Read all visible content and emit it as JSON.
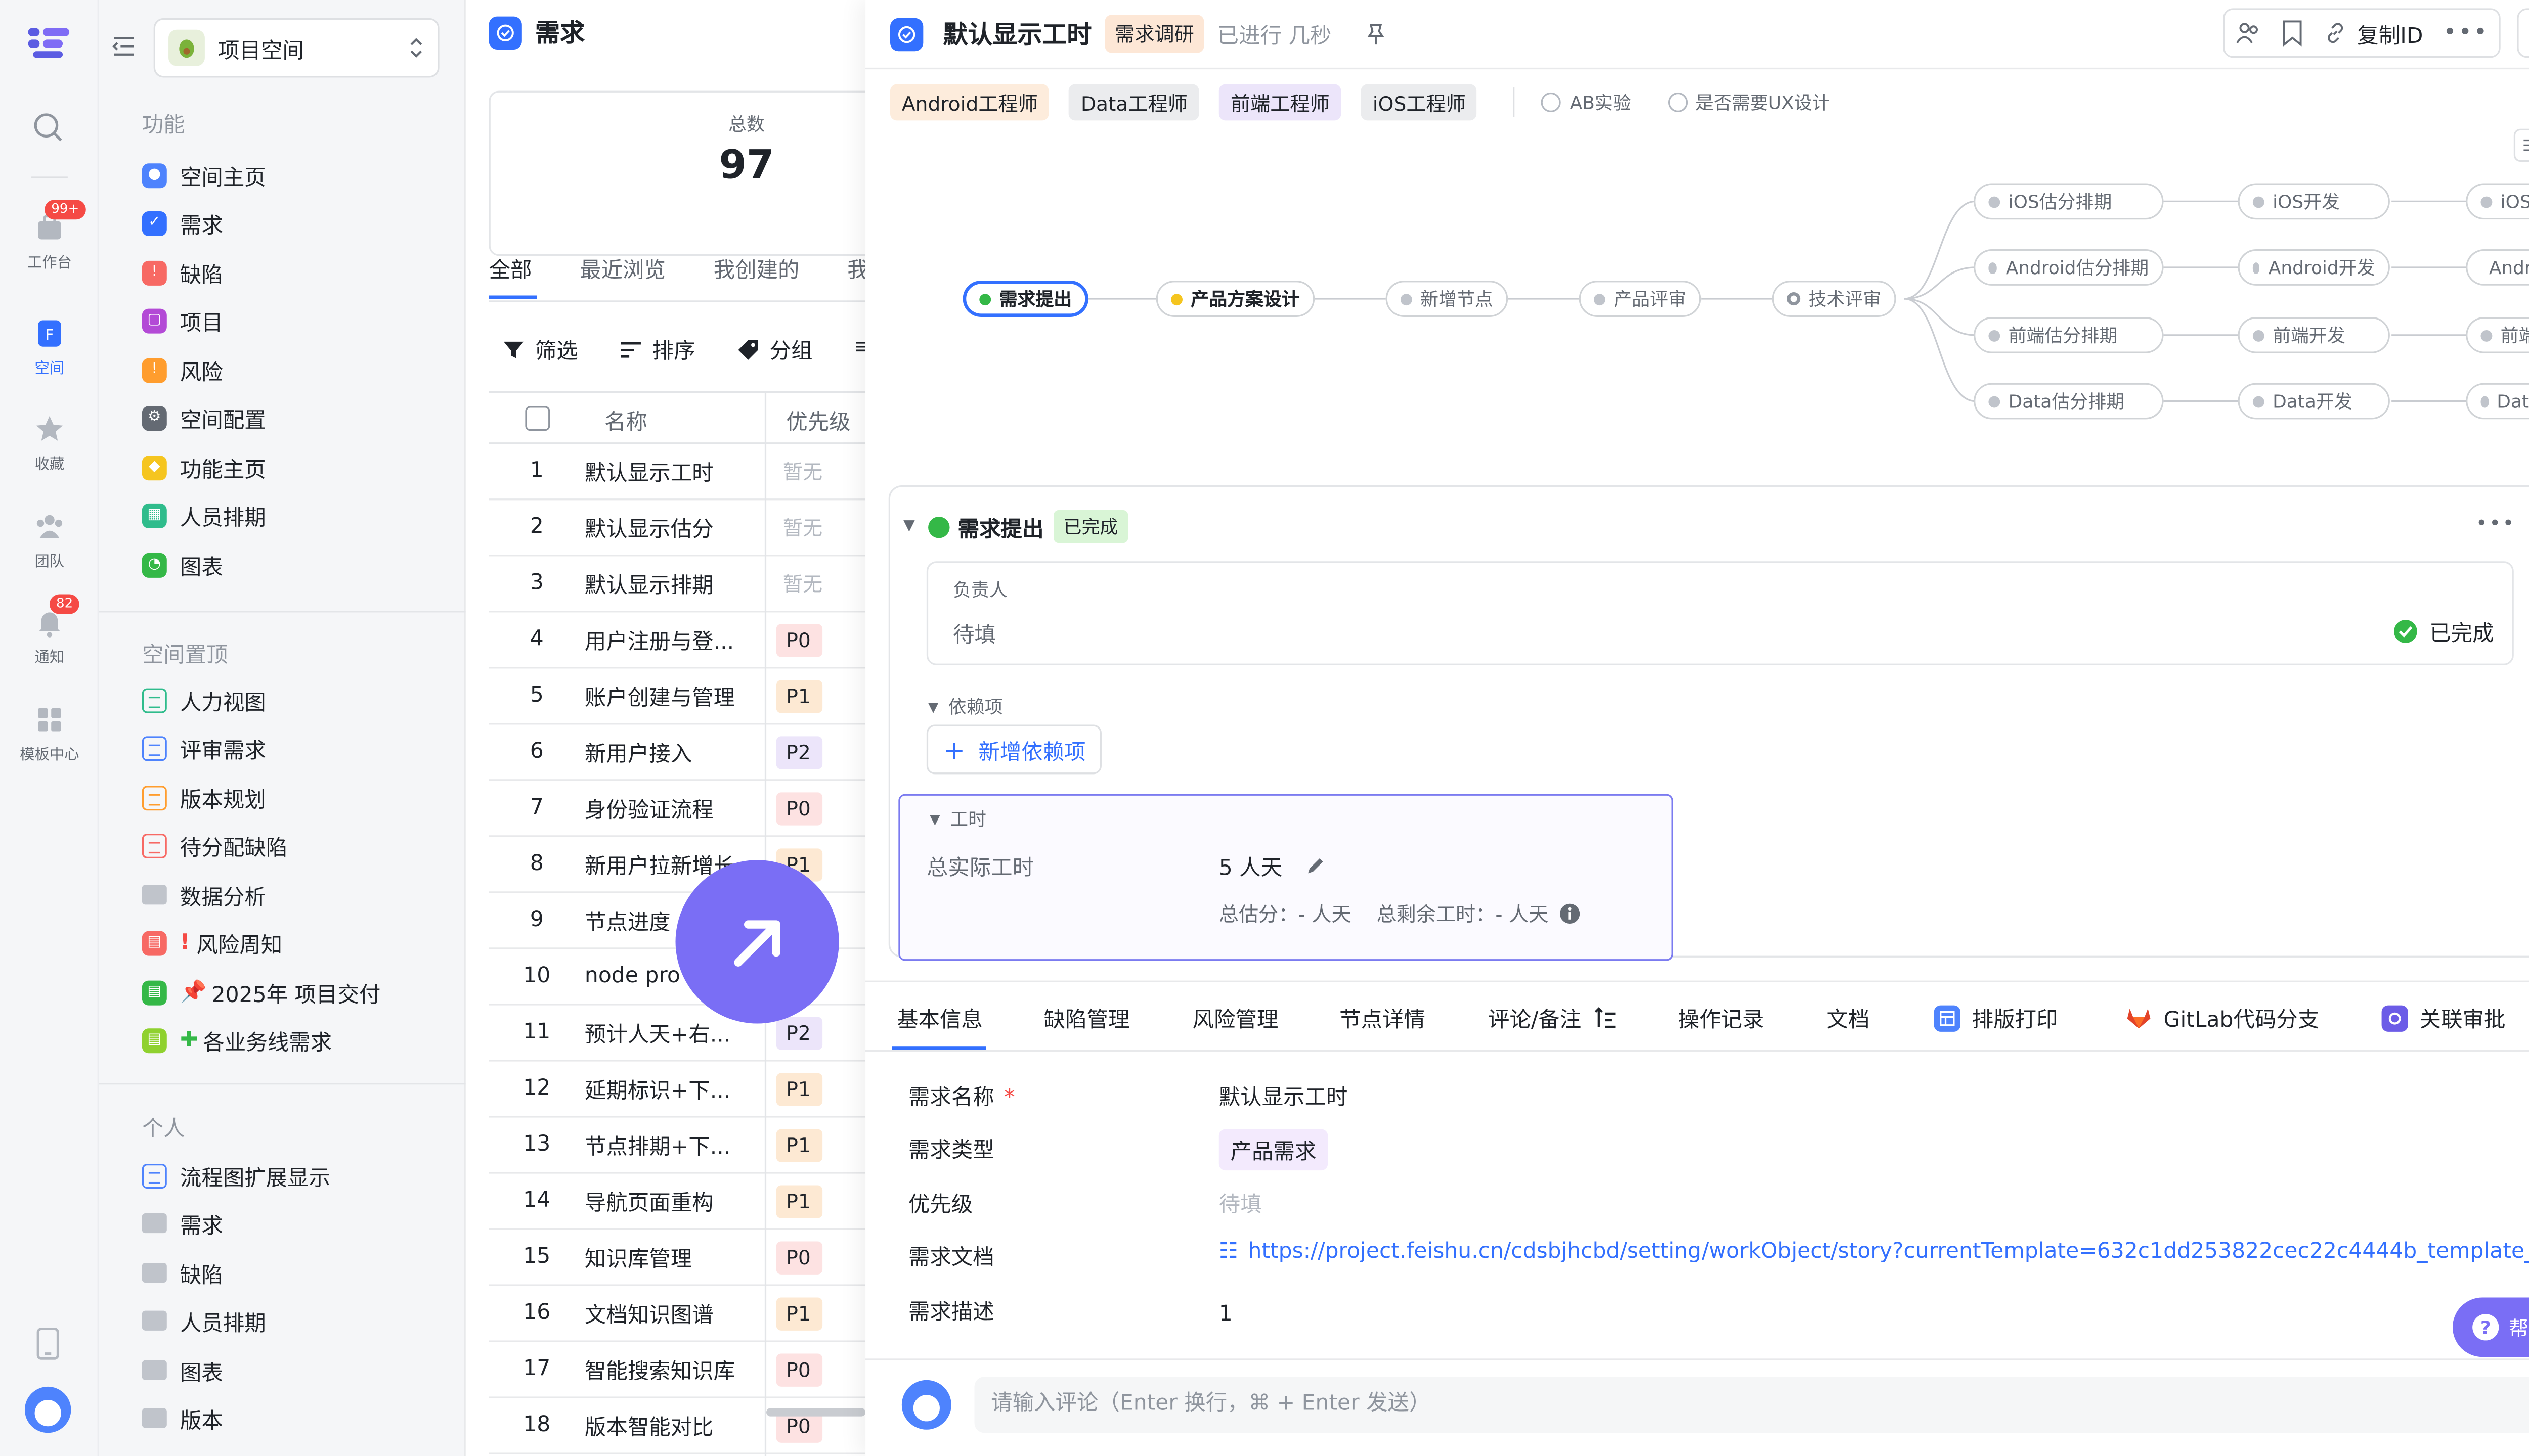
{
  "rail": {
    "items": [
      {
        "label": "工作台",
        "badge": "99+"
      },
      {
        "label": "空间"
      },
      {
        "label": "收藏"
      },
      {
        "label": "团队"
      },
      {
        "label": "通知",
        "badge": "82"
      },
      {
        "label": "模板中心"
      }
    ]
  },
  "sidebar": {
    "space_name": "项目空间",
    "section_features": "功能",
    "features": [
      "空间主页",
      "需求",
      "缺陷",
      "项目",
      "风险",
      "空间配置",
      "功能主页",
      "人员排期",
      "图表"
    ],
    "section_pinned": "空间置顶",
    "pinned": [
      "人力视图",
      "评审需求",
      "版本规划",
      "待分配缺陷",
      "数据分析",
      "风险周知",
      "2025年 项目交付",
      "各业务线需求"
    ],
    "section_personal": "个人",
    "personal": [
      "流程图扩展显示",
      "需求",
      "缺陷",
      "人员排期",
      "图表",
      "版本"
    ]
  },
  "list": {
    "title": "需求",
    "total_label": "总数",
    "total_value": "97",
    "tabs": [
      "全部",
      "最近浏览",
      "我创建的",
      "我"
    ],
    "tools": [
      "筛选",
      "排序",
      "分组"
    ],
    "col_name": "名称",
    "col_priority": "优先级",
    "rows": [
      {
        "no": "1",
        "name": "默认显示工时",
        "priority": "暂无"
      },
      {
        "no": "2",
        "name": "默认显示估分",
        "priority": "暂无"
      },
      {
        "no": "3",
        "name": "默认显示排期",
        "priority": "暂无"
      },
      {
        "no": "4",
        "name": "用户注册与登...",
        "priority": "P0"
      },
      {
        "no": "5",
        "name": "账户创建与管理",
        "priority": "P1"
      },
      {
        "no": "6",
        "name": "新用户接入",
        "priority": "P2"
      },
      {
        "no": "7",
        "name": "身份验证流程",
        "priority": "P0"
      },
      {
        "no": "8",
        "name": "新用户拉新增长",
        "priority": "P1"
      },
      {
        "no": "9",
        "name": "节点进度",
        "priority": ""
      },
      {
        "no": "10",
        "name": "node pro",
        "priority": ""
      },
      {
        "no": "11",
        "name": "预计人天+右...",
        "priority": "P2"
      },
      {
        "no": "12",
        "name": "延期标识+下...",
        "priority": "P1"
      },
      {
        "no": "13",
        "name": "节点排期+下...",
        "priority": "P1"
      },
      {
        "no": "14",
        "name": "导航页面重构",
        "priority": "P1"
      },
      {
        "no": "15",
        "name": "知识库管理",
        "priority": "P0"
      },
      {
        "no": "16",
        "name": "文档知识图谱",
        "priority": "P1"
      },
      {
        "no": "17",
        "name": "智能搜索知识库",
        "priority": "P0"
      },
      {
        "no": "18",
        "name": "版本智能对比",
        "priority": "P0"
      }
    ]
  },
  "detail": {
    "title": "默认显示工时",
    "status_tag": "需求调研",
    "progress_text": "已进行 几秒",
    "copy_id": "复制ID",
    "role_chips": [
      "Android工程师",
      "Data工程师",
      "前端工程师",
      "iOS工程师"
    ],
    "checkbox_options": [
      "AB实验",
      "是否需要UX设计"
    ],
    "flow": {
      "main": [
        "需求提出",
        "产品方案设计",
        "新增节点",
        "产品评审",
        "技术评审"
      ],
      "branches": [
        [
          "iOS估分排期",
          "iOS开发",
          "iOS测试"
        ],
        [
          "Android估分排期",
          "Android开发",
          "Android测"
        ],
        [
          "前端估分排期",
          "前端开发",
          "前端测试"
        ],
        [
          "Data估分排期",
          "Data开发",
          "Data测试"
        ]
      ]
    },
    "node_panel": {
      "name": "需求提出",
      "status": "已完成",
      "owner_label": "负责人",
      "owner_value": "待填",
      "done_label": "已完成",
      "deps_label": "依赖项",
      "add_dep": "新增依赖项",
      "hours_label": "工时",
      "actual_label": "总实际工时",
      "actual_value": "5 人天",
      "summary": "总估分：- 人天    总剩余工时：- 人天"
    },
    "tabs": [
      "基本信息",
      "缺陷管理",
      "风险管理",
      "节点详情",
      "评论/备注",
      "操作记录",
      "文档",
      "排版打印",
      "GitLab代码分支",
      "关联审批"
    ],
    "fields": [
      {
        "label": "需求名称",
        "value": "默认显示工时"
      },
      {
        "label": "需求类型",
        "value": "产品需求"
      },
      {
        "label": "优先级",
        "value": "待填"
      },
      {
        "label": "需求文档",
        "value": "https://project.feishu.cn/cdsbjhcbd/setting/workObject/story?currentTemplate=632c1dd253822cec22c4444b_template_16..."
      },
      {
        "label": "需求描述",
        "value": "1"
      }
    ],
    "help": "帮助",
    "comment_placeholder": "请输入评论（Enter 换行，⌘ + Enter 发送）"
  }
}
